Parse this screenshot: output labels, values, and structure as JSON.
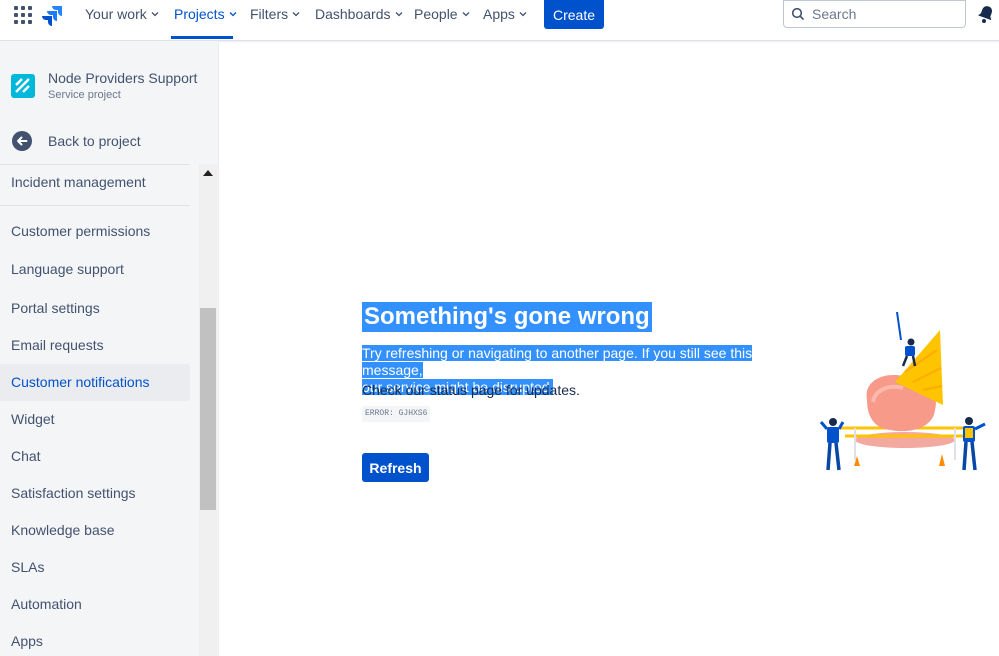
{
  "topnav": {
    "items": [
      {
        "label": "Your work"
      },
      {
        "label": "Projects"
      },
      {
        "label": "Filters"
      },
      {
        "label": "Dashboards"
      },
      {
        "label": "People"
      },
      {
        "label": "Apps"
      }
    ],
    "active_item": "Projects",
    "create_label": "Create",
    "search_placeholder": "Search",
    "icons": [
      "app-switcher-icon",
      "jira-logo-icon",
      "chevron-down-icon",
      "search-icon",
      "notification-icon"
    ]
  },
  "sidebar": {
    "project_name": "Node Providers Support",
    "project_type": "Service project",
    "back_label": "Back to project",
    "items": [
      {
        "label": "Incident management"
      },
      {
        "label": "Customer permissions"
      },
      {
        "label": "Language support"
      },
      {
        "label": "Portal settings"
      },
      {
        "label": "Email requests"
      },
      {
        "label": "Customer notifications"
      },
      {
        "label": "Widget"
      },
      {
        "label": "Chat"
      },
      {
        "label": "Satisfaction settings"
      },
      {
        "label": "Knowledge base"
      },
      {
        "label": "SLAs"
      },
      {
        "label": "Automation"
      },
      {
        "label": "Apps"
      }
    ],
    "selected_item": "Customer notifications"
  },
  "main": {
    "error_title": "Something's gone wrong",
    "error_message_line1": "Try refreshing or navigating to another page. If you still see this message,",
    "error_message_line2": "our service might be disrupted.",
    "status_text": "Check our status page for updates.",
    "error_code": "ERROR: GJHXS6",
    "refresh_label": "Refresh"
  },
  "colors": {
    "brand_blue": "#0052cc",
    "selection_highlight": "#3390ff",
    "sidebar_bg": "#f4f5f7",
    "text_primary": "#172b4d",
    "text_secondary": "#42526e"
  }
}
